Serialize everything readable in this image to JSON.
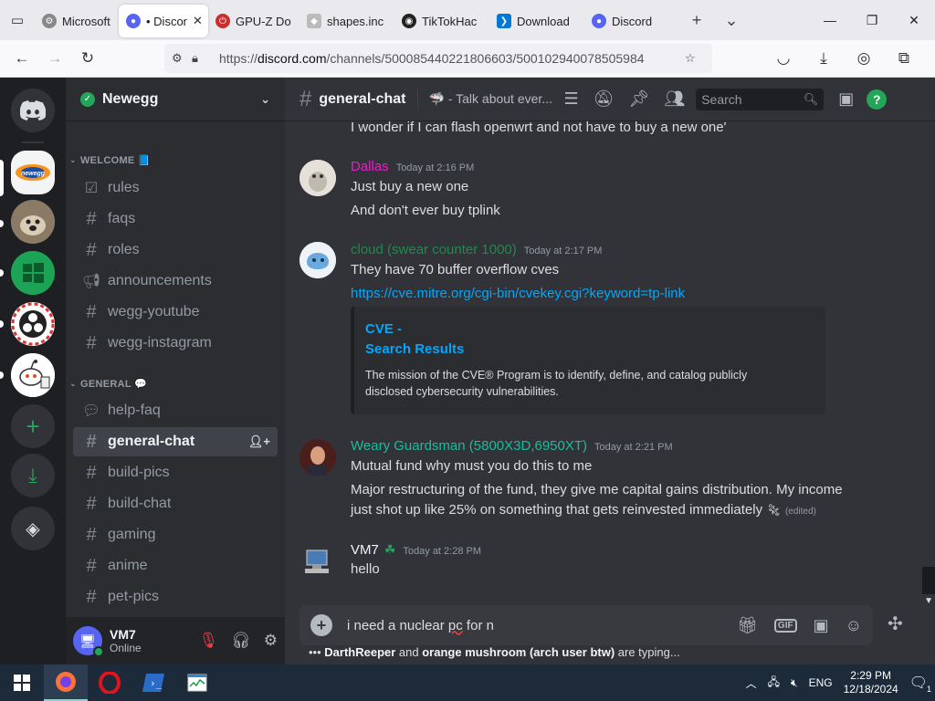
{
  "browser": {
    "tabs": [
      {
        "label": "Microsoft",
        "color": "#f25022"
      },
      {
        "label": "• Discor",
        "color": "#5865f2"
      },
      {
        "label": "GPU-Z Do",
        "color": "#c9302c"
      },
      {
        "label": "shapes.inc",
        "color": "#888888"
      },
      {
        "label": "TikTokHac",
        "color": "#222222"
      },
      {
        "label": "Download",
        "color": "#0078d4"
      },
      {
        "label": "Discord",
        "color": "#5865f2"
      }
    ],
    "url_prefix": "https://",
    "url_host": "discord.com",
    "url_path": "/channels/500085440221806603/500102940078505984"
  },
  "server": {
    "name": "Newegg",
    "categories": [
      {
        "label": "WELCOME 📘"
      },
      {
        "label": "GENERAL 💬"
      }
    ],
    "channels": [
      {
        "name": "rules",
        "icon": "rules-icon"
      },
      {
        "name": "faqs",
        "icon": "hash-icon"
      },
      {
        "name": "roles",
        "icon": "hash-icon"
      },
      {
        "name": "announcements",
        "icon": "announcement-icon"
      },
      {
        "name": "wegg-youtube",
        "icon": "hash-icon"
      },
      {
        "name": "wegg-instagram",
        "icon": "hash-icon"
      },
      {
        "name": "help-faq",
        "icon": "forum-icon"
      },
      {
        "name": "general-chat",
        "icon": "hash-icon"
      },
      {
        "name": "build-pics",
        "icon": "hash-icon"
      },
      {
        "name": "build-chat",
        "icon": "hash-icon"
      },
      {
        "name": "gaming",
        "icon": "hash-icon"
      },
      {
        "name": "anime",
        "icon": "hash-icon"
      },
      {
        "name": "pet-pics",
        "icon": "hash-icon"
      }
    ]
  },
  "user": {
    "name": "VM7",
    "status": "Online"
  },
  "chat": {
    "channel": "general-chat",
    "topic": "🦈 - Talk about ever...",
    "search_placeholder": "Search",
    "messages": [
      {
        "text": "I wonder if I can flash openwrt and not have to buy a new one'"
      },
      {
        "author": "Dallas",
        "color": "#e91ec6",
        "time": "Today at 2:16 PM",
        "lines": [
          "Just buy a new one",
          "And don't ever buy tplink"
        ]
      },
      {
        "author": "cloud (swear counter 1000)",
        "color": "#1f8b4c",
        "time": "Today at 2:17 PM",
        "lines": [
          "They have 70 buffer overflow cves",
          "https://cve.mitre.org/cgi-bin/cvekey.cgi?keyword=tp-link"
        ]
      },
      {
        "author": "Weary Guardsman (5800X3D,6950XT)",
        "color": "#1abc9c",
        "time": "Today at 2:21 PM",
        "lines": [
          "Mutual fund why must you do this to me",
          "Major restructuring of the fund, they give me capital gains distribution. My income",
          "just shot up like 25% on something that gets reinvested immediately"
        ],
        "edited": "(edited)"
      },
      {
        "author": "VM7",
        "color": "#f2f3f5",
        "time": "Today at 2:28 PM",
        "lines": [
          "hello"
        ]
      }
    ],
    "embed": {
      "title_1": "CVE -",
      "title_2": "Search Results",
      "desc_1": "The mission of the CVE® Program is to identify, define, and catalog publicly",
      "desc_2": "disclosed cybersecurity vulnerabilities."
    },
    "composer_text_a": "i need a nuclear ",
    "composer_text_b": "pc",
    "composer_text_c": " for n",
    "gif_label": "GIF",
    "typing_user1": "DarthReeper",
    "typing_and": " and ",
    "typing_user2": "orange mushroom (arch user btw)",
    "typing_tail": " are typing..."
  },
  "taskbar": {
    "lang": "ENG",
    "time": "2:29 PM",
    "date": "12/18/2024",
    "notif_count": "1"
  }
}
